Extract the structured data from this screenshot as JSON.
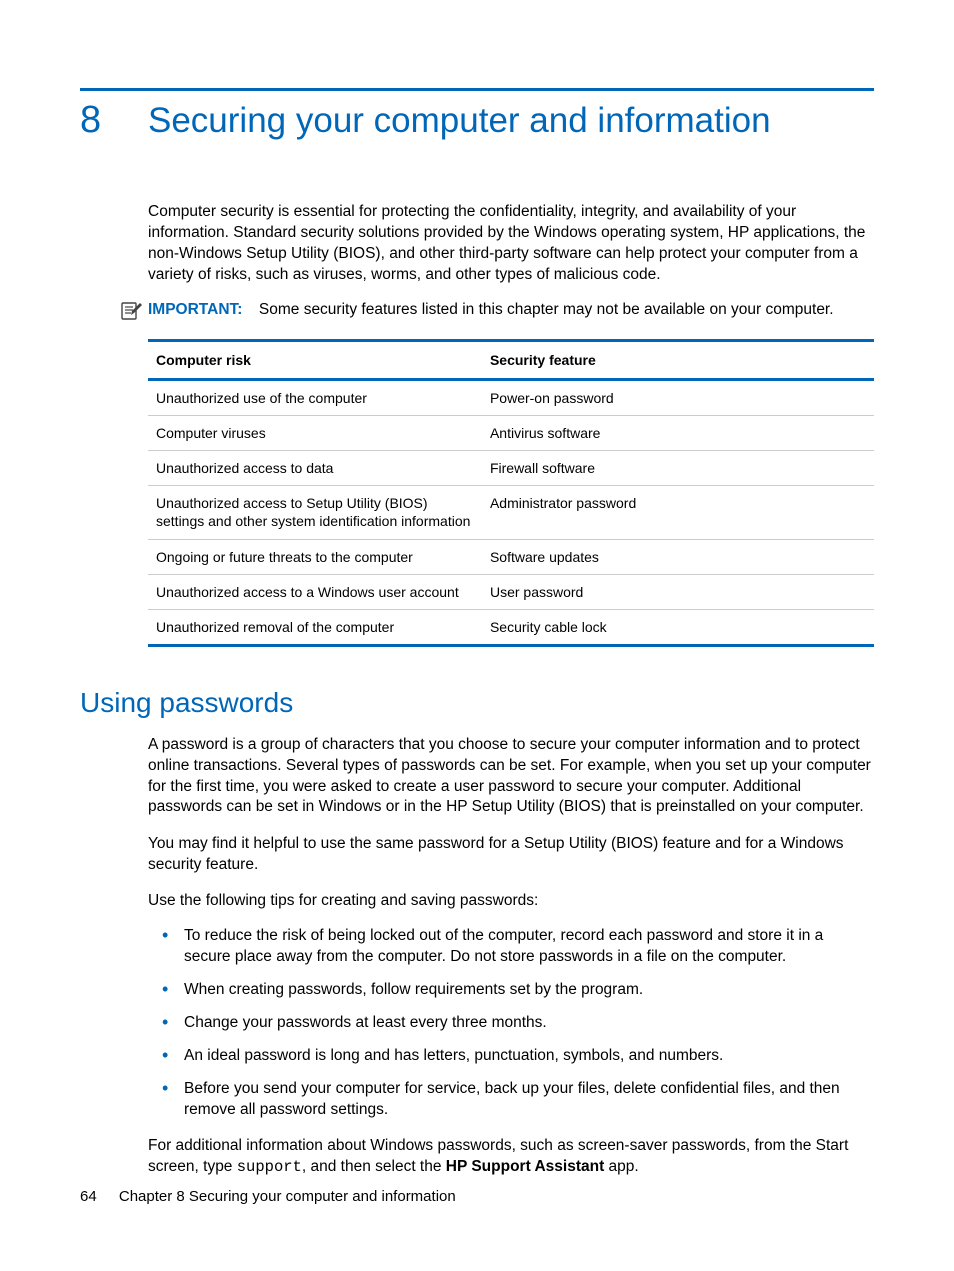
{
  "chapter": {
    "number": "8",
    "title": "Securing your computer and information"
  },
  "intro_para": "Computer security is essential for protecting the confidentiality, integrity, and availability of your information. Standard security solutions provided by the Windows operating system, HP applications, the non-Windows Setup Utility (BIOS), and other third-party software can help protect your computer from a variety of risks, such as viruses, worms, and other types of malicious code.",
  "important": {
    "label": "IMPORTANT:",
    "text": "Some security features listed in this chapter may not be available on your computer."
  },
  "table": {
    "headers": {
      "col1": "Computer risk",
      "col2": "Security feature"
    },
    "rows": [
      {
        "risk": "Unauthorized use of the computer",
        "feature": "Power-on password"
      },
      {
        "risk": "Computer viruses",
        "feature": "Antivirus software"
      },
      {
        "risk": "Unauthorized access to data",
        "feature": "Firewall software"
      },
      {
        "risk": "Unauthorized access to Setup Utility (BIOS) settings and other system identification information",
        "feature": "Administrator password"
      },
      {
        "risk": "Ongoing or future threats to the computer",
        "feature": "Software updates"
      },
      {
        "risk": "Unauthorized access to a Windows user account",
        "feature": "User password"
      },
      {
        "risk": "Unauthorized removal of the computer",
        "feature": "Security cable lock"
      }
    ]
  },
  "section2": {
    "heading": "Using passwords",
    "p1": "A password is a group of characters that you choose to secure your computer information and to protect online transactions. Several types of passwords can be set. For example, when you set up your computer for the first time, you were asked to create a user password to secure your computer. Additional passwords can be set in Windows or in the HP Setup Utility (BIOS) that is preinstalled on your computer.",
    "p2": "You may find it helpful to use the same password for a Setup Utility (BIOS) feature and for a Windows security feature.",
    "p3": "Use the following tips for creating and saving passwords:",
    "bullets": [
      "To reduce the risk of being locked out of the computer, record each password and store it in a secure place away from the computer. Do not store passwords in a file on the computer.",
      "When creating passwords, follow requirements set by the program.",
      "Change your passwords at least every three months.",
      "An ideal password is long and has letters, punctuation, symbols, and numbers.",
      "Before you send your computer for service, back up your files, delete confidential files, and then remove all password settings."
    ],
    "p4_pre": "For additional information about Windows passwords, such as screen-saver passwords, from the Start screen, type ",
    "p4_code": "support",
    "p4_mid": ", and then select the ",
    "p4_bold": "HP Support Assistant",
    "p4_post": " app."
  },
  "footer": {
    "page_number": "64",
    "text": "Chapter 8   Securing your computer and information"
  }
}
